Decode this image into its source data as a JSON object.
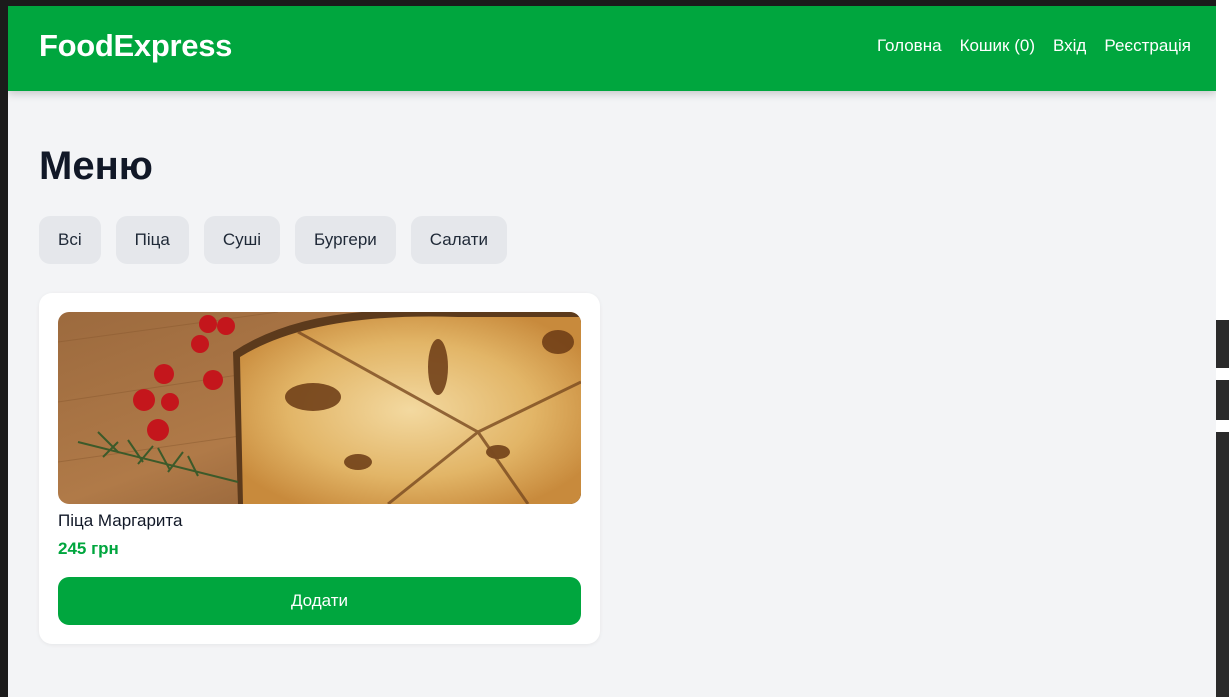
{
  "header": {
    "logo": "FoodExpress",
    "nav": [
      {
        "label": "Головна"
      },
      {
        "label": "Кошик (0)"
      },
      {
        "label": "Вхід"
      },
      {
        "label": "Реєстрація"
      }
    ],
    "accent_color": "#00a63e"
  },
  "main": {
    "title": "Меню",
    "filters": [
      {
        "label": "Всі"
      },
      {
        "label": "Піца"
      },
      {
        "label": "Суші"
      },
      {
        "label": "Бургери"
      },
      {
        "label": "Салати"
      }
    ],
    "products": [
      {
        "name": "Піца Маргарита",
        "price": "245 грн",
        "add_label": "Додати",
        "image": "pizza-photo"
      }
    ]
  }
}
